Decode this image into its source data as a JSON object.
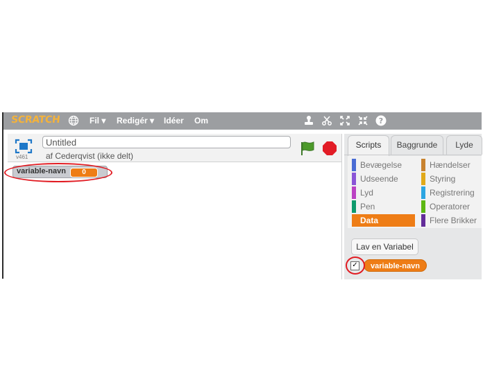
{
  "menubar": {
    "logo": "SCRATCH",
    "items": [
      "Fil ▾",
      "Redigér ▾",
      "Idéer",
      "Om"
    ]
  },
  "project": {
    "title": "Untitled",
    "byline": "af Cederqvist (ikke delt)",
    "version": "v461"
  },
  "monitor": {
    "name": "variable-navn",
    "value": "0"
  },
  "tabs": [
    "Scripts",
    "Baggrunde",
    "Lyde"
  ],
  "categories": [
    {
      "label": "Bevægelse",
      "color": "#4a6cd4"
    },
    {
      "label": "Hændelser",
      "color": "#c88330"
    },
    {
      "label": "Udseende",
      "color": "#8a55d7"
    },
    {
      "label": "Styring",
      "color": "#e1a91a"
    },
    {
      "label": "Lyd",
      "color": "#bb42c3"
    },
    {
      "label": "Registrering",
      "color": "#2ca5e2"
    },
    {
      "label": "Pen",
      "color": "#0e9a6c"
    },
    {
      "label": "Operatorer",
      "color": "#5cb712"
    },
    {
      "label": "Data",
      "color": "#ee7d16"
    },
    {
      "label": "Flere Brikker",
      "color": "#632d99"
    }
  ],
  "palette": {
    "make_variable": "Lav en Variabel",
    "variable_block": "variable-navn",
    "checkbox_mark": "✓"
  },
  "colors": {
    "menubar": "#9c9ea1",
    "data_orange": "#ee7d16",
    "highlight_red": "#e11b22"
  }
}
